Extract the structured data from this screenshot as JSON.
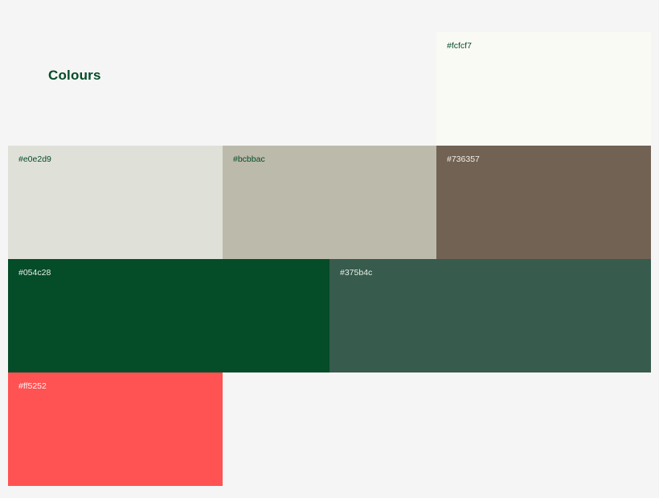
{
  "title": "Colours",
  "swatches": [
    {
      "label": "#fcfcf7",
      "color": "#fafaf5",
      "text_color": "#054c28"
    },
    {
      "label": "#e0e2d9",
      "color": "#dfe0d8",
      "text_color": "#054c28"
    },
    {
      "label": "#bcbbac",
      "color": "#bcbaab",
      "text_color": "#054c28"
    },
    {
      "label": "#736357",
      "color": "#716254",
      "text_color": "#f2efe8"
    },
    {
      "label": "#054c28",
      "color": "#054c28",
      "text_color": "#e8efe9"
    },
    {
      "label": "#375b4c",
      "color": "#375b4c",
      "text_color": "#e8efe9"
    },
    {
      "label": "#ff5252",
      "color": "#ff5252",
      "text_color": "#fff2f2"
    }
  ]
}
